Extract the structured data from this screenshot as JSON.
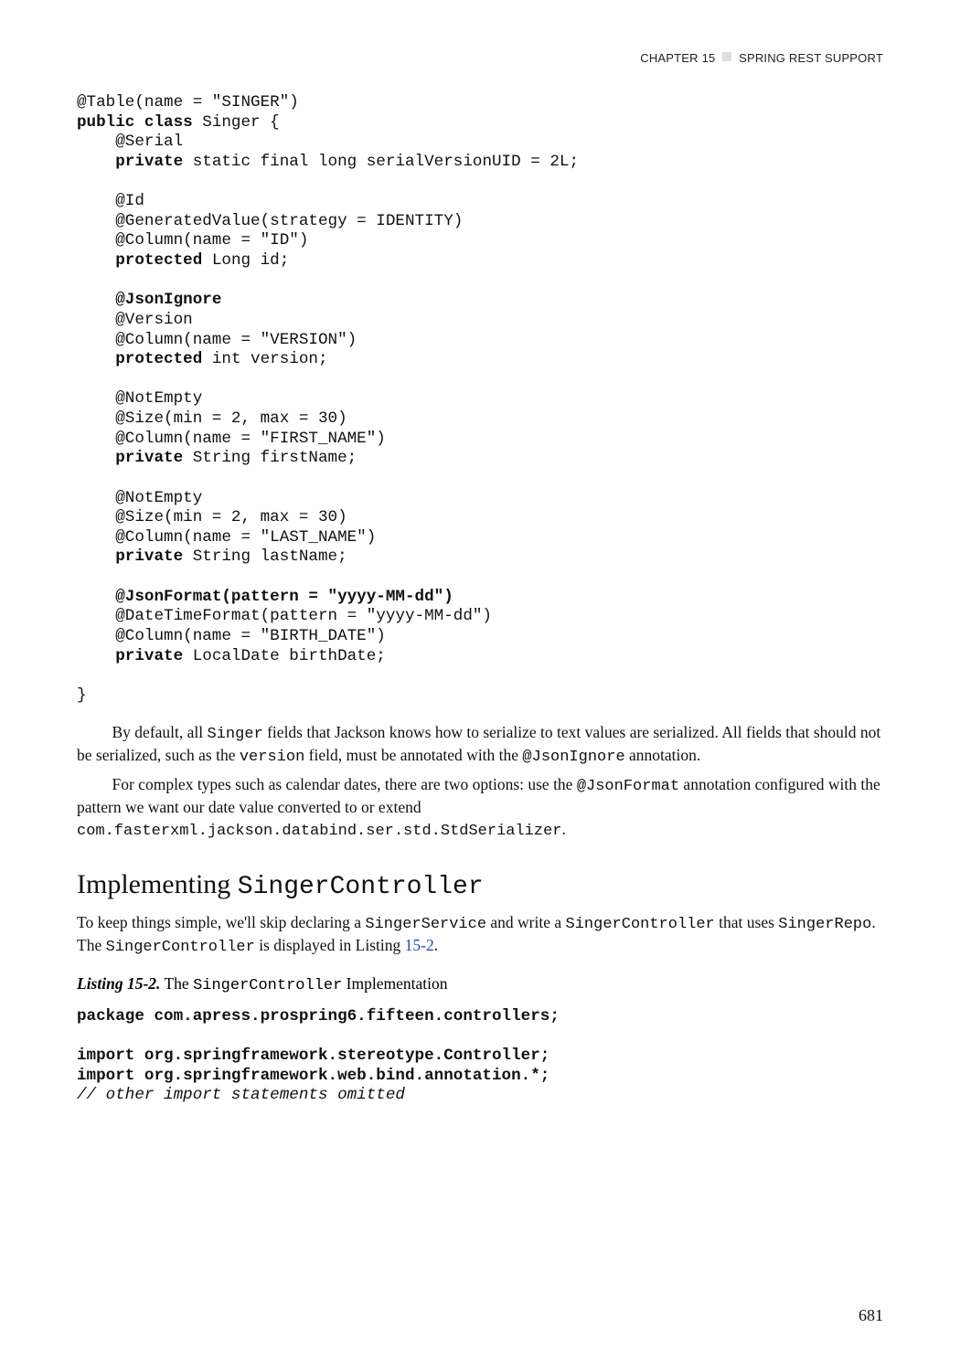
{
  "header": {
    "chapter": "CHAPTER 15",
    "title": "SPRING REST SUPPORT"
  },
  "code": {
    "l01": "@Table(name = \"SINGER\")",
    "l02a": "public class",
    "l02b": " Singer {",
    "l03": "    @Serial",
    "l04a": "    ",
    "l04b": "private",
    "l04c": " static final long serialVersionUID = 2L;",
    "l05": "",
    "l06": "    @Id",
    "l07": "    @GeneratedValue(strategy = IDENTITY)",
    "l08": "    @Column(name = \"ID\")",
    "l09a": "    ",
    "l09b": "protected",
    "l09c": " Long id;",
    "l10": "",
    "l11a": "    ",
    "l11b": "@JsonIgnore",
    "l12": "    @Version",
    "l13": "    @Column(name = \"VERSION\")",
    "l14a": "    ",
    "l14b": "protected",
    "l14c": " int version;",
    "l15": "",
    "l16": "    @NotEmpty",
    "l17": "    @Size(min = 2, max = 30)",
    "l18": "    @Column(name = \"FIRST_NAME\")",
    "l19a": "    ",
    "l19b": "private",
    "l19c": " String firstName;",
    "l20": "",
    "l21": "    @NotEmpty",
    "l22": "    @Size(min = 2, max = 30)",
    "l23": "    @Column(name = \"LAST_NAME\")",
    "l24a": "    ",
    "l24b": "private",
    "l24c": " String lastName;",
    "l25": "",
    "l26a": "    ",
    "l26b": "@JsonFormat(pattern = \"yyyy-MM-dd\")",
    "l27": "    @DateTimeFormat(pattern = \"yyyy-MM-dd\")",
    "l28": "    @Column(name = \"BIRTH_DATE\")",
    "l29a": "    ",
    "l29b": "private",
    "l29c": " LocalDate birthDate;",
    "l30": "",
    "l31": "}"
  },
  "para1": {
    "t1": "By default, all ",
    "m1": "Singer",
    "t2": " fields that Jackson knows how to serialize to text values are serialized. All fields that should not be serialized, such as the ",
    "m2": "version",
    "t3": " field, must be annotated with the ",
    "m3": "@JsonIgnore",
    "t4": " annotation."
  },
  "para2": {
    "t1": "For complex types such as calendar dates, there are two options: use the ",
    "m1": "@JsonFormat",
    "t2": " annotation configured with the pattern we want our date value converted to or extend ",
    "m2": "com.fasterxml.jackson.databind.ser.std.StdSerializer",
    "t3": "."
  },
  "section": {
    "t1": "Implementing ",
    "m1": "SingerController"
  },
  "para3": {
    "t1": "To keep things simple, we'll skip declaring a ",
    "m1": "SingerService",
    "t2": " and write a ",
    "m2": "SingerController",
    "t3": " that uses ",
    "m3": "SingerRepo",
    "t4": ". The ",
    "m4": "SingerController",
    "t5": " is displayed in Listing ",
    "link": "15-2",
    "t6": "."
  },
  "listing": {
    "label": "Listing 15-2.",
    "t1": "  The ",
    "m1": "SingerController",
    "t2": " Implementation"
  },
  "code2": {
    "l1": "package com.apress.prospring6.fifteen.controllers;",
    "l2": "",
    "l3": "import org.springframework.stereotype.Controller;",
    "l4": "import org.springframework.web.bind.annotation.*;",
    "l5": "// other import statements omitted"
  },
  "page_number": "681"
}
